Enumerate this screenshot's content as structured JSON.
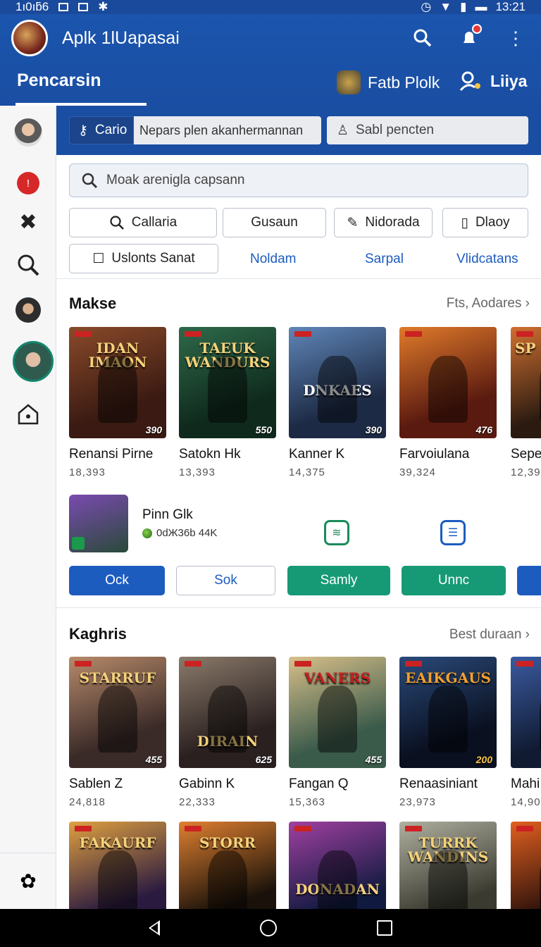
{
  "status_bar": {
    "left_text": "1ı0ıƃ6",
    "time": "13:21"
  },
  "appbar": {
    "title": "Aplk 1lUapasai",
    "tab_main": "Pencarsin",
    "tab2": "Fatb Plolk",
    "tab3": "Liiya"
  },
  "filters": {
    "chip1": "Cario",
    "input1": "Nepars plen akanhermannan",
    "input2_placeholder": "Sabl pencten"
  },
  "search": {
    "placeholder": "Moak arenigla capsann"
  },
  "chips": {
    "c1": "Callaria",
    "c2": "Gusaun",
    "c3": "Nidorada",
    "c4": "Dlaoy",
    "c5": "Uslonts Sanat",
    "link1": "Noldam",
    "link2": "Sarpal",
    "link3": "Vlidcatans"
  },
  "section1": {
    "title": "Makse",
    "link": "Fts, Aodares",
    "cards": [
      {
        "cover_title": "IDAN\nIMAON",
        "num": "390",
        "name": "Renansi Pirne",
        "count": "18,393"
      },
      {
        "cover_title": "TAEUK\nWANDURS",
        "num": "550",
        "name": "Satokn Hk",
        "count": "13,393"
      },
      {
        "cover_title": "DNKAES",
        "num": "390",
        "name": "Kanner K",
        "count": "14,375"
      },
      {
        "cover_title": "",
        "num": "476",
        "name": "Farvoiulana",
        "count": "39,324"
      },
      {
        "cover_title": "SP",
        "num": "",
        "name": "Sepe",
        "count": "12,39"
      }
    ]
  },
  "featured": {
    "name": "Pinn Glk",
    "meta": "0dЖ36b  44K",
    "buttons": {
      "b1": "Ock",
      "b2": "Sok",
      "b3": "Samly",
      "b4": "Unnc"
    }
  },
  "section2": {
    "title": "Kaghris",
    "link": "Best duraan",
    "cards": [
      {
        "cover_title": "STARRUF",
        "num": "455",
        "name": "Sablen Z",
        "count": "24,818"
      },
      {
        "cover_title": "DIRAIN",
        "num": "625",
        "name": "Gabinn K",
        "count": "22,333"
      },
      {
        "cover_title": "VANERS",
        "num": "455",
        "name": "Fangan Q",
        "count": "15,363"
      },
      {
        "cover_title": "EAIKGAUS",
        "num": "200",
        "name": "Renaasiniant",
        "count": "23,973"
      },
      {
        "cover_title": "",
        "num": "",
        "name": "Mahi",
        "count": "14,90"
      }
    ]
  },
  "section3": {
    "cards": [
      {
        "cover_title": "FAKAURF"
      },
      {
        "cover_title": "STORR"
      },
      {
        "cover_title": "DONADAN"
      },
      {
        "cover_title": "TURRK\nWANDINS"
      },
      {
        "cover_title": ""
      }
    ]
  }
}
